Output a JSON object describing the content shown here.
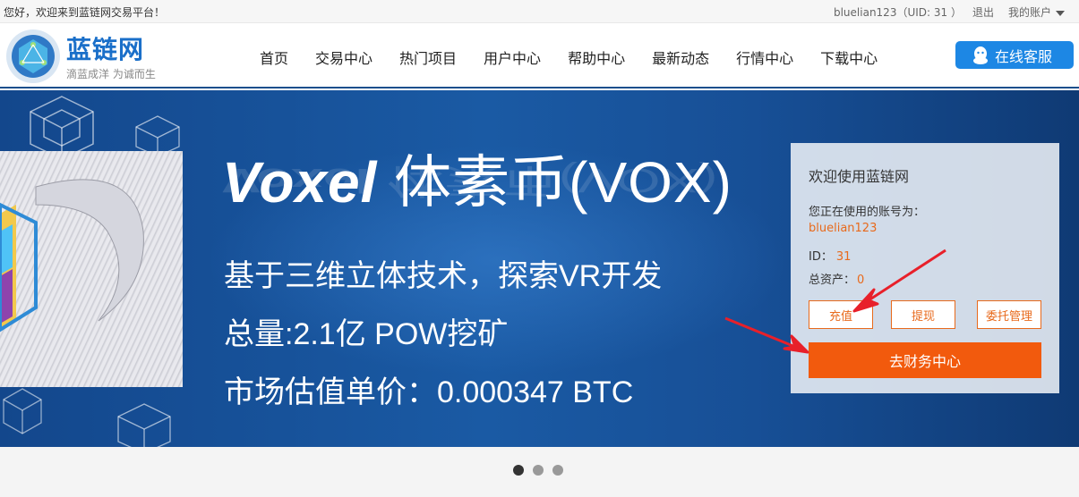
{
  "topbar": {
    "welcome": "您好，欢迎来到蓝链网交易平台！",
    "user": "bluelian123（UID: 31 ）",
    "logout": "退出",
    "account": "我的账户"
  },
  "brand": {
    "name": "蓝链网",
    "slogan": "滴蓝成洋 为诚而生"
  },
  "nav": [
    "首页",
    "交易中心",
    "热门项目",
    "用户中心",
    "帮助中心",
    "最新动态",
    "行情中心",
    "下载中心"
  ],
  "service_button": "在线客服",
  "banner": {
    "headline_latin": "Voxel",
    "headline_cn": " 体素币(VOX)",
    "line1": "基于三维立体技术，探索VR开发",
    "line2": "总量:2.1亿 POW挖矿",
    "line3": "市场估值单价：0.000347 BTC"
  },
  "panel": {
    "title": "欢迎使用蓝链网",
    "account_label": "您正在使用的账号为：",
    "account": "bluelian123",
    "id_label": "ID：",
    "id": "31",
    "assets_label": "总资产：",
    "assets": "0",
    "recharge": "充值",
    "withdraw": "提现",
    "entrust": "委托管理",
    "finance": "去财务中心"
  },
  "colors": {
    "brand_blue": "#1a6fc9",
    "accent_orange": "#f25a0d",
    "banner_blue": "#1a5aa4"
  },
  "carousel": {
    "slides": 3,
    "active": 1
  }
}
